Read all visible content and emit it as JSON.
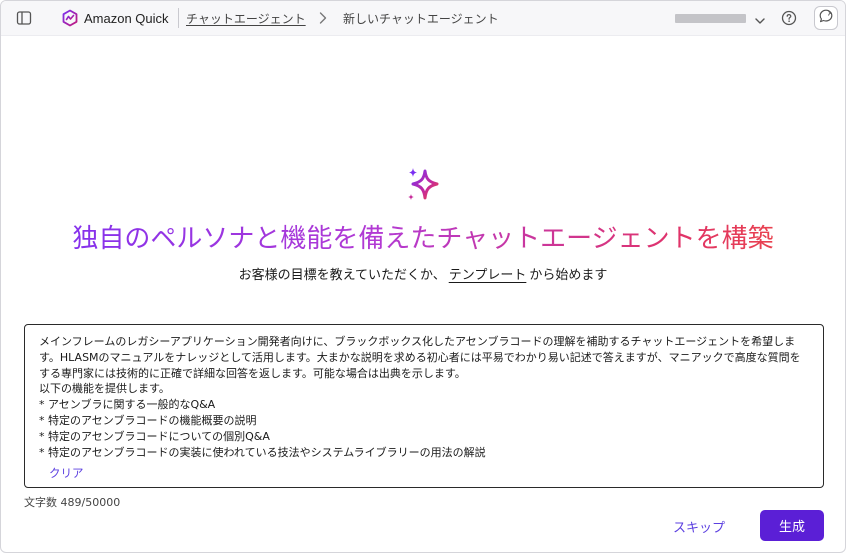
{
  "header": {
    "brand_name": "Amazon Quick",
    "breadcrumb_parent": "チャットエージェント",
    "breadcrumb_current": "新しいチャットエージェント"
  },
  "icons": {
    "sidebar_toggle": "sidebar-toggle-icon",
    "brand_logo": "amazon-quick-logo-icon",
    "breadcrumb_separator": "chevron-right-icon",
    "account_chevron": "chevron-down-icon",
    "help": "help-circle-icon",
    "assistant": "chat-assistant-icon",
    "hero": "sparkle-icon"
  },
  "colors": {
    "accent": "#5b1fd6",
    "link": "#5b3fe0",
    "title_gradient_start": "#7b2ff2",
    "title_gradient_end": "#ef4b3a"
  },
  "hero": {
    "title": "独自のペルソナと機能を備えたチャットエージェントを構築",
    "subtitle_before": "お客様の目標を教えていただくか、",
    "subtitle_link": "テンプレート",
    "subtitle_after": "から始めます"
  },
  "description": {
    "value": "メインフレームのレガシーアプリケーション開発者向けに、ブラックボックス化したアセンブラコードの理解を補助するチャットエージェントを希望します。HLASMのマニュアルをナレッジとして活用します。大まかな説明を求める初心者には平易でわかり易い記述で答えますが、マニアックで高度な質問をする専門家には技術的に正確で詳細な回答を返します。可能な場合は出典を示します。\n以下の機能を提供します。\n* アセンブラに関する一般的なQ&A\n* 特定のアセンブラコードの機能概要の説明\n* 特定のアセンブラコードについての個別Q&A\n* 特定のアセンブラコードの実装に使われている技法やシステムライブラリーの用法の解説",
    "clear_label": "クリア",
    "char_count": "文字数 489/50000"
  },
  "footer": {
    "skip_label": "スキップ",
    "generate_label": "生成"
  }
}
